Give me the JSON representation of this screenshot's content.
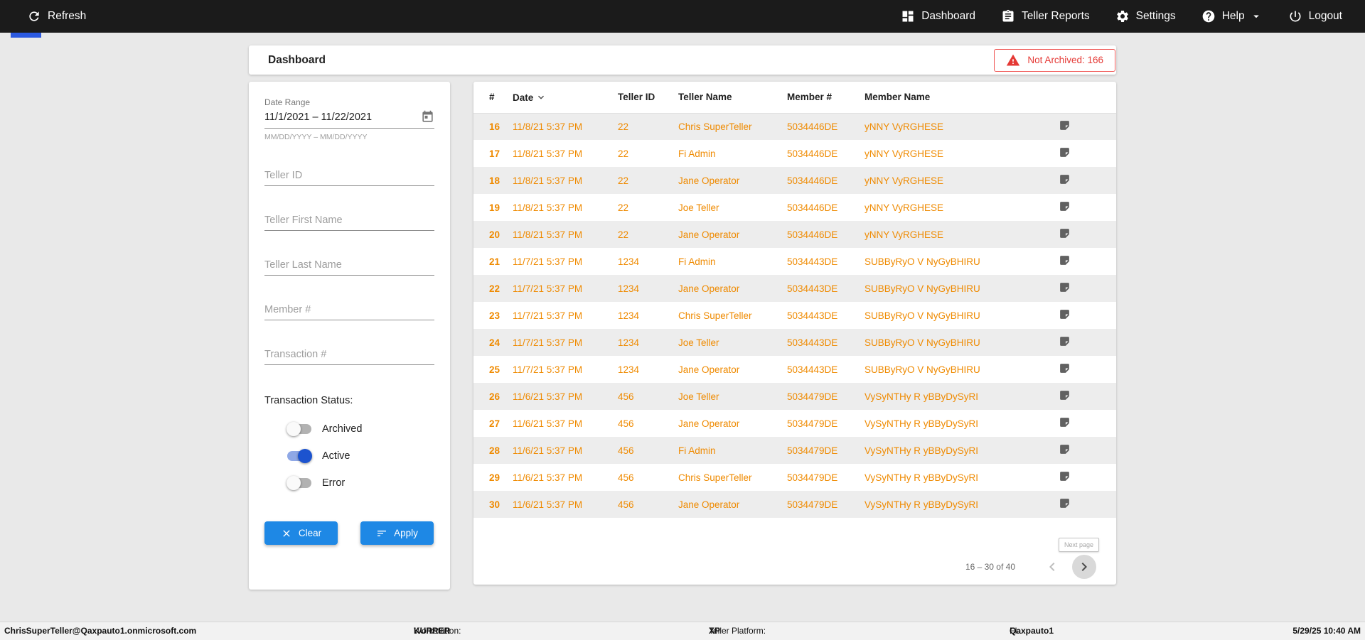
{
  "colors": {
    "topbar_bg": "#1b1b1b",
    "accent_blue": "#1e88e5",
    "toggle_blue": "#1c53cf",
    "indicator_blue": "#2b59e0",
    "row_text_orange": "#ef8a00",
    "alert_red": "#e53935",
    "stripe_gray": "#ededed"
  },
  "topbar": {
    "refresh_label": "Refresh",
    "nav": [
      {
        "label": "Dashboard",
        "icon": "dashboard-icon"
      },
      {
        "label": "Teller Reports",
        "icon": "reports-icon"
      },
      {
        "label": "Settings",
        "icon": "settings-icon"
      },
      {
        "label": "Help",
        "icon": "help-icon"
      },
      {
        "label": "Logout",
        "icon": "logout-icon"
      }
    ]
  },
  "header": {
    "title": "Dashboard",
    "not_archived": "Not Archived: 166"
  },
  "filters": {
    "date_range_label": "Date Range",
    "date_range_value": "11/1/2021 – 11/22/2021",
    "date_range_hint": "MM/DD/YYYY – MM/DD/YYYY",
    "fields": [
      {
        "placeholder": "Teller ID"
      },
      {
        "placeholder": "Teller First Name"
      },
      {
        "placeholder": "Teller Last Name"
      },
      {
        "placeholder": "Member #"
      },
      {
        "placeholder": "Transaction #"
      }
    ],
    "status_label": "Transaction Status:",
    "toggles": [
      {
        "label": "Archived",
        "on": false
      },
      {
        "label": "Active",
        "on": true
      },
      {
        "label": "Error",
        "on": false
      }
    ],
    "clear_label": "Clear",
    "apply_label": "Apply"
  },
  "table": {
    "columns": [
      "#",
      "Date",
      "Teller ID",
      "Teller Name",
      "Member #",
      "Member Name"
    ],
    "rows": [
      {
        "num": "16",
        "date": "11/8/21 5:37 PM",
        "teller_id": "22",
        "teller_name": "Chris SuperTeller",
        "member_num": "5034446DE",
        "member_name": "yNNY VyRGHESE"
      },
      {
        "num": "17",
        "date": "11/8/21 5:37 PM",
        "teller_id": "22",
        "teller_name": "Fi Admin",
        "member_num": "5034446DE",
        "member_name": "yNNY VyRGHESE"
      },
      {
        "num": "18",
        "date": "11/8/21 5:37 PM",
        "teller_id": "22",
        "teller_name": "Jane Operator",
        "member_num": "5034446DE",
        "member_name": "yNNY VyRGHESE"
      },
      {
        "num": "19",
        "date": "11/8/21 5:37 PM",
        "teller_id": "22",
        "teller_name": "Joe Teller",
        "member_num": "5034446DE",
        "member_name": "yNNY VyRGHESE"
      },
      {
        "num": "20",
        "date": "11/8/21 5:37 PM",
        "teller_id": "22",
        "teller_name": "Jane Operator",
        "member_num": "5034446DE",
        "member_name": "yNNY VyRGHESE"
      },
      {
        "num": "21",
        "date": "11/7/21 5:37 PM",
        "teller_id": "1234",
        "teller_name": "Fi Admin",
        "member_num": "5034443DE",
        "member_name": "SUBByRyO V NyGyBHIRU"
      },
      {
        "num": "22",
        "date": "11/7/21 5:37 PM",
        "teller_id": "1234",
        "teller_name": "Jane Operator",
        "member_num": "5034443DE",
        "member_name": "SUBByRyO V NyGyBHIRU"
      },
      {
        "num": "23",
        "date": "11/7/21 5:37 PM",
        "teller_id": "1234",
        "teller_name": "Chris SuperTeller",
        "member_num": "5034443DE",
        "member_name": "SUBByRyO V NyGyBHIRU"
      },
      {
        "num": "24",
        "date": "11/7/21 5:37 PM",
        "teller_id": "1234",
        "teller_name": "Joe Teller",
        "member_num": "5034443DE",
        "member_name": "SUBByRyO V NyGyBHIRU"
      },
      {
        "num": "25",
        "date": "11/7/21 5:37 PM",
        "teller_id": "1234",
        "teller_name": "Jane Operator",
        "member_num": "5034443DE",
        "member_name": "SUBByRyO V NyGyBHIRU"
      },
      {
        "num": "26",
        "date": "11/6/21 5:37 PM",
        "teller_id": "456",
        "teller_name": "Joe Teller",
        "member_num": "5034479DE",
        "member_name": "VySyNTHy R yBByDySyRI"
      },
      {
        "num": "27",
        "date": "11/6/21 5:37 PM",
        "teller_id": "456",
        "teller_name": "Jane Operator",
        "member_num": "5034479DE",
        "member_name": "VySyNTHy R yBByDySyRI"
      },
      {
        "num": "28",
        "date": "11/6/21 5:37 PM",
        "teller_id": "456",
        "teller_name": "Fi Admin",
        "member_num": "5034479DE",
        "member_name": "VySyNTHy R yBByDySyRI"
      },
      {
        "num": "29",
        "date": "11/6/21 5:37 PM",
        "teller_id": "456",
        "teller_name": "Chris SuperTeller",
        "member_num": "5034479DE",
        "member_name": "VySyNTHy R yBByDySyRI"
      },
      {
        "num": "30",
        "date": "11/6/21 5:37 PM",
        "teller_id": "456",
        "teller_name": "Jane Operator",
        "member_num": "5034479DE",
        "member_name": "VySyNTHy R yBByDySyRI"
      }
    ],
    "pagination": {
      "range_label": "16 – 30 of 40",
      "next_tooltip": "Next page"
    }
  },
  "footer": {
    "user": "ChrisSuperTeller@Qaxpauto1.onmicrosoft.com",
    "workstation_label": "Workstation:",
    "workstation_value": "KURRER",
    "platform_label": "Teller Platform:",
    "platform_value": "XP",
    "fi_label": "FI:",
    "fi_value": "Qaxpauto1",
    "datetime": "5/29/25 10:40 AM"
  }
}
